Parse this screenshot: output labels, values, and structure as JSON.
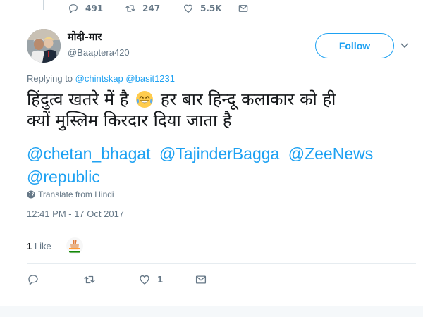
{
  "prev_tweet": {
    "reply_count": "491",
    "retweet_count": "247",
    "like_count": "5.5K"
  },
  "user": {
    "display_name": "मोदी-मार",
    "handle": "@Baaptera420"
  },
  "follow_label": "Follow",
  "replying": {
    "prefix": "Replying to",
    "mentions": [
      "@chintskap",
      "@basit1231"
    ]
  },
  "tweet": {
    "line1_a": "हिंदुत्व खतरे में है",
    "emoji": "face-with-tears-of-joy",
    "line1_b": "हर बार हिन्दू कलाकार को ही",
    "line2": "क्यों मुस्लिम किरदार दिया जाता है",
    "mentions": [
      "@chetan_bhagat",
      "@TajinderBagga",
      "@ZeeNews",
      "@republic"
    ]
  },
  "translate_label": "Translate from Hindi",
  "timestamp": "12:41 PM - 17 Oct 2017",
  "likes": {
    "count": "1",
    "label": "Like"
  },
  "actions": {
    "reply_count": "",
    "retweet_count": "",
    "like_count": "1"
  },
  "colors": {
    "accent": "#1da1f2",
    "secondary_text": "#657786",
    "divider": "#e6ecf0"
  },
  "icons": {
    "reply": "reply-icon",
    "retweet": "retweet-icon",
    "like": "heart-icon",
    "dm": "envelope-icon",
    "chevron": "chevron-down-icon",
    "globe": "globe-icon"
  }
}
